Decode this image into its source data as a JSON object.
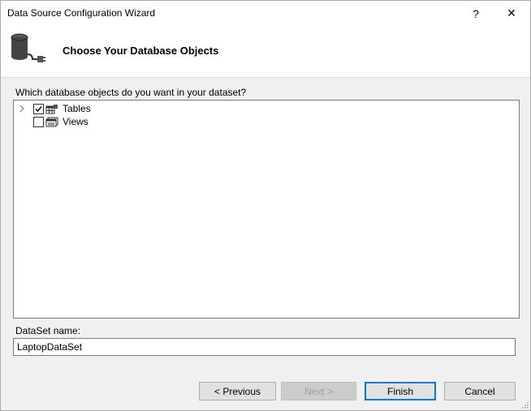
{
  "window": {
    "title": "Data Source Configuration Wizard",
    "help_glyph": "?",
    "close_glyph": "✕"
  },
  "header": {
    "title": "Choose Your Database Objects",
    "icon": "database-connection-icon"
  },
  "objects": {
    "prompt": "Which database objects do you want in your dataset?",
    "items": [
      {
        "label": "Tables",
        "checked": true,
        "expandable": true,
        "icon": "table-icon"
      },
      {
        "label": "Views",
        "checked": false,
        "expandable": false,
        "icon": "view-icon"
      }
    ]
  },
  "dataset": {
    "label": "DataSet name:",
    "value": "LaptopDataSet"
  },
  "buttons": {
    "previous": "< Previous",
    "next": "Next >",
    "finish": "Finish",
    "cancel": "Cancel"
  },
  "colors": {
    "accent": "#0078d7",
    "disabled_text": "#9d9d9d"
  }
}
